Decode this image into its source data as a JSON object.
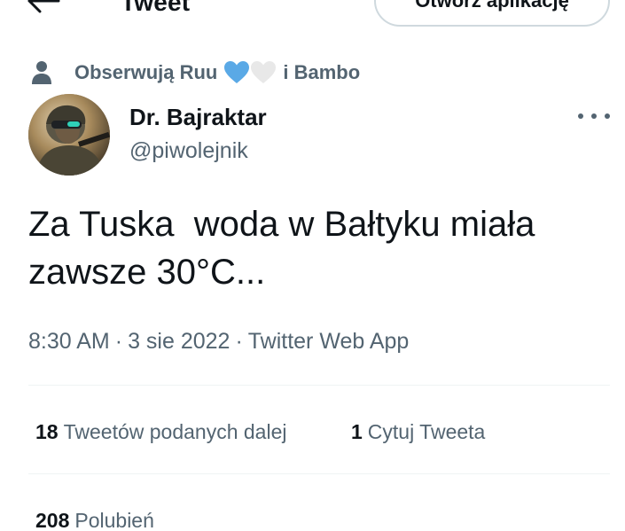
{
  "header": {
    "title": "Tweet",
    "open_app_label": "Otwórz aplikację"
  },
  "social_context": {
    "prefix": "Obserwują Ruu",
    "suffix": "i Bambo",
    "hearts": [
      "blue-heart",
      "white-heart"
    ]
  },
  "author": {
    "name": "Dr. Bajraktar",
    "handle": "@piwolejnik"
  },
  "tweet": {
    "text": "Za Tuska  woda w Bałtyku miała zawsze 30°C..."
  },
  "meta": {
    "time": "8:30 AM",
    "separator": "·",
    "date": "3 sie 2022",
    "source": "Twitter Web App"
  },
  "stats": {
    "retweets": {
      "count": "18",
      "label": "Tweetów podanych dalej"
    },
    "quotes": {
      "count": "1",
      "label": "Cytuj Tweeta"
    },
    "likes": {
      "count": "208",
      "label": "Polubień"
    }
  },
  "colors": {
    "primary_text": "#0f1419",
    "secondary_text": "#536471",
    "border": "#cfd9de",
    "divider": "#eff3f4",
    "blue_heart": "#5aa9e6",
    "white_heart": "#e8e8e8"
  },
  "icons": {
    "back": "arrow-left-icon",
    "person": "person-icon",
    "more": "more-dots-icon"
  }
}
